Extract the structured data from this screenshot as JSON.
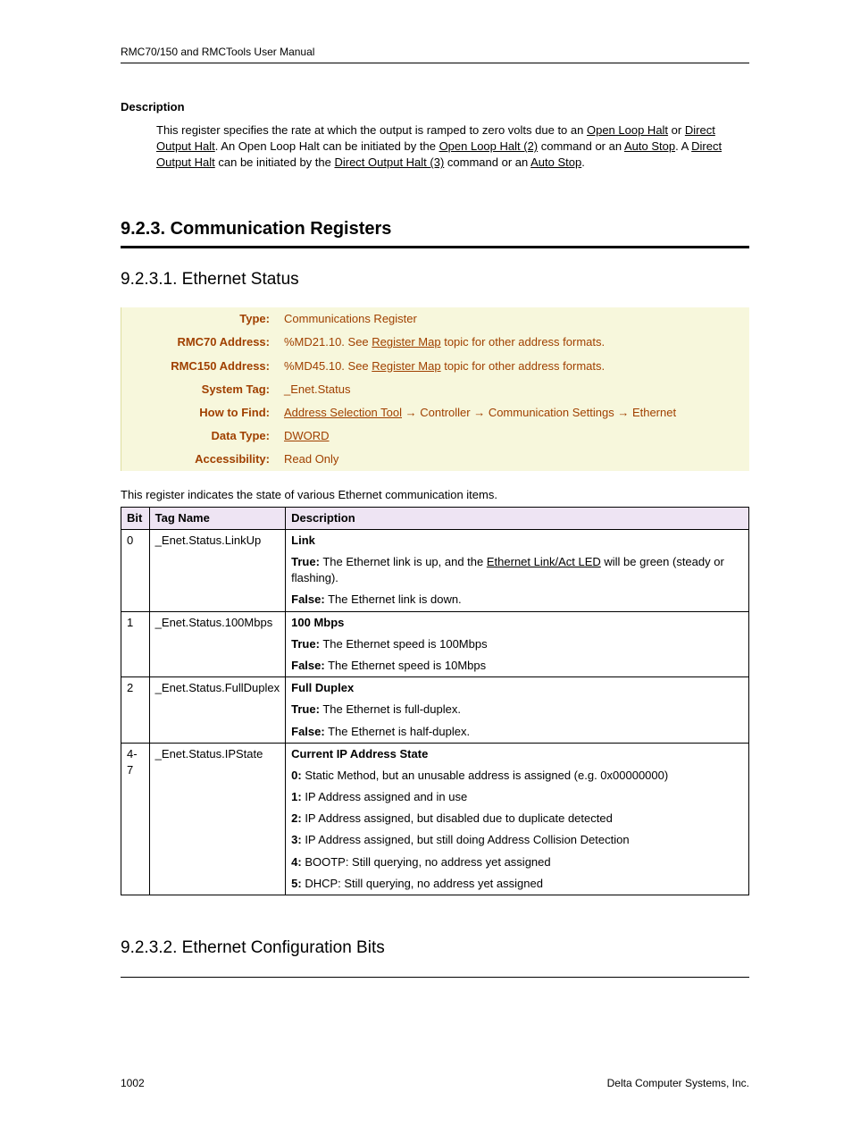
{
  "header": "RMC70/150 and RMCTools User Manual",
  "descriptionHeading": "Description",
  "descBody": {
    "p1a": "This register specifies the rate at which the output is ramped to zero volts due to an ",
    "link1": "Open Loop Halt",
    "p1b": " or ",
    "link2": "Direct Output Halt",
    "p1c": ".  An Open Loop Halt can be initiated by the ",
    "link3": "Open Loop Halt (2)",
    "p1d": " command or an ",
    "link4": "Auto Stop",
    "p1e": ". A ",
    "link5": "Direct Output Halt",
    "p1f": " can be initiated by the ",
    "link6": "Direct Output Halt (3)",
    "p1g": " command or an ",
    "link7": "Auto Stop",
    "p1h": "."
  },
  "sectionTitle": "9.2.3. Communication Registers",
  "sub1Title": "9.2.3.1. Ethernet Status",
  "info": {
    "typeLabel": "Type:",
    "typeValue": "Communications Register",
    "r70Label": "RMC70 Address:",
    "r70a": "%MD21.10. See ",
    "r70link": "Register Map",
    "r70b": " topic for other address formats.",
    "r150Label": "RMC150 Address:",
    "r150a": "%MD45.10. See ",
    "r150link": "Register Map",
    "r150b": " topic for other address formats.",
    "tagLabel": "System Tag:",
    "tagValue": "_Enet.Status",
    "findLabel": "How to Find:",
    "findLink": "Address Selection Tool",
    "findRest": " → Controller → Communication Settings → Ethernet",
    "dtLabel": "Data Type:",
    "dtLink": "DWORD",
    "accLabel": "Accessibility:",
    "accValue": "Read Only"
  },
  "introLine": "This register indicates the state of various Ethernet communication items.",
  "th": {
    "bit": "Bit",
    "tag": "Tag Name",
    "desc": "Description"
  },
  "rows": {
    "r0": {
      "bit": "0",
      "tag": "_Enet.Status.LinkUp",
      "title": "Link",
      "trueLabel": "True:",
      "truea": " The Ethernet link is up, and the ",
      "truelink": "Ethernet Link/Act LED",
      "trueb": " will be green (steady or flashing).",
      "falseLabel": "False:",
      "falseText": " The Ethernet link is down."
    },
    "r1": {
      "bit": "1",
      "tag": "_Enet.Status.100Mbps",
      "title": "100 Mbps",
      "trueLabel": "True:",
      "trueText": " The Ethernet speed is 100Mbps",
      "falseLabel": "False:",
      "falseText": " The Ethernet speed is 10Mbps"
    },
    "r2": {
      "bit": "2",
      "tag": "_Enet.Status.FullDuplex",
      "title": "Full Duplex",
      "trueLabel": "True:",
      "trueText": " The Ethernet is full-duplex.",
      "falseLabel": "False:",
      "falseText": " The Ethernet is half-duplex."
    },
    "r3": {
      "bit": "4-7",
      "tag": "_Enet.Status.IPState",
      "title": "Current IP Address State",
      "l0a": "0:",
      "l0b": " Static Method, but an unusable address is assigned (e.g. 0x00000000)",
      "l1a": "1:",
      "l1b": " IP Address assigned and in use",
      "l2a": "2:",
      "l2b": " IP Address assigned, but disabled due to duplicate detected",
      "l3a": "3:",
      "l3b": " IP Address assigned, but still doing Address Collision Detection",
      "l4a": "4:",
      "l4b": " BOOTP: Still querying, no address yet assigned",
      "l5a": "5:",
      "l5b": " DHCP: Still querying, no address yet assigned"
    }
  },
  "sub2Title": "9.2.3.2. Ethernet Configuration Bits",
  "footer": {
    "page": "1002",
    "company": "Delta Computer Systems, Inc."
  }
}
